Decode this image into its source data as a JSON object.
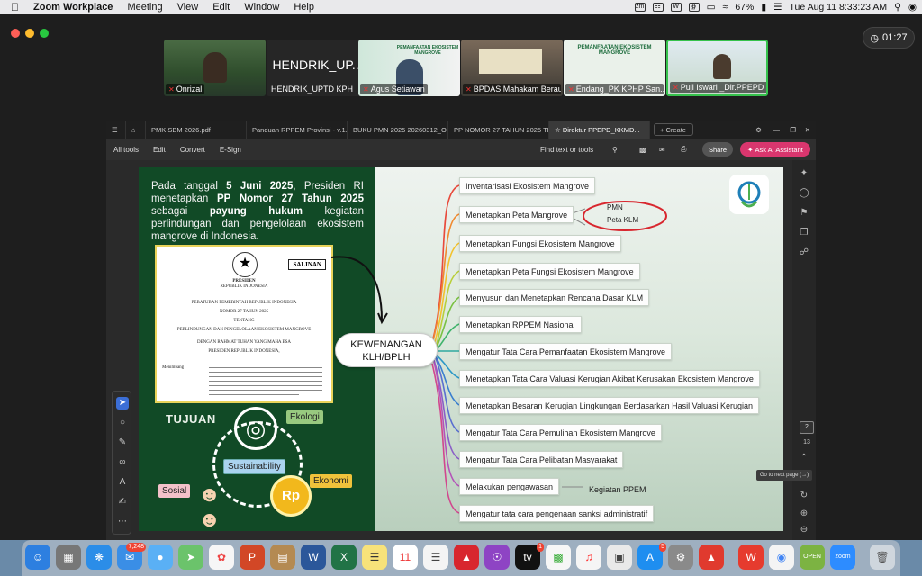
{
  "menubar": {
    "app": "Zoom Workplace",
    "items": [
      "Meeting",
      "View",
      "Edit",
      "Window",
      "Help"
    ],
    "battery": "67%",
    "clock": "Tue Aug 11  8:33:23 AM"
  },
  "zoom": {
    "timer": "01:27",
    "participants": [
      {
        "name": "Onrizal",
        "kind": "video"
      },
      {
        "name": "HENDRIK_UPTD KPH",
        "kind": "name",
        "big": "HENDRIK_UP..."
      },
      {
        "name": "Agus Setiawan",
        "kind": "video"
      },
      {
        "name": "BPDAS Mahakam Berau",
        "kind": "video"
      },
      {
        "name": "Endang_PK KPHP San...",
        "kind": "slide"
      },
      {
        "name": "Puji Iswari _Dir.PPEPD KL...",
        "kind": "video"
      }
    ]
  },
  "acrobat": {
    "tabs": [
      "PMK SBM 2026.pdf",
      "Panduan RPPEM Provinsi - v.1.5 ...",
      "BUKU PMN 2025 20260312_OK...",
      "PP NOMOR 27 TAHUN 2025 TE...",
      "Direktur PPEPD_KKMD..."
    ],
    "create_label": "Create",
    "toolbar": [
      "All tools",
      "Edit",
      "Convert",
      "E-Sign"
    ],
    "find_label": "Find text or tools",
    "share_label": "Share",
    "ai_label": "Ask AI Assistant",
    "page_current": "2",
    "page_total": "13",
    "tooltip": "Go to next page (→)"
  },
  "slide": {
    "intro_parts": [
      "Pada tanggal ",
      "5 Juni 2025",
      ", Presiden RI menetapkan ",
      "PP Nomor 27 Tahun 2025",
      " sebagai ",
      "payung hukum",
      " kegiatan perlindungan dan pengelolaan ekosistem mangrove di Indonesia."
    ],
    "doc": {
      "stamp": "SALINAN",
      "presiden": "PRESIDEN",
      "republik": "REPUBLIK INDONESIA",
      "line1": "PERATURAN PEMERINTAH REPUBLIK INDONESIA",
      "line2": "NOMOR 27 TAHUN 2025",
      "line3": "TENTANG",
      "line4": "PERLINDUNGAN DAN PENGELOLAAN EKOSISTEM MANGROVE",
      "line5": "DENGAN RAHMAT TUHAN YANG MAHA ESA",
      "line6": "PRESIDEN REPUBLIK INDONESIA,",
      "menimbang": "Menimbang"
    },
    "center": "KEWENANGAN KLH/BPLH",
    "tujuan": "TUJUAN",
    "goals": {
      "ekologi": "Ekologi",
      "sustainability": "Sustainability",
      "ekonomi": "Ekonomi",
      "sosial": "Sosial",
      "coin": "Rp"
    },
    "items": [
      "Inventarisasi Ekosistem Mangrove",
      "Menetapkan Peta Mangrove",
      "Menetapkan Fungsi Ekosistem Mangrove",
      "Menetapkan Peta Fungsi Ekosistem Mangrove",
      "Menyusun dan Menetapkan Rencana Dasar KLM",
      "Menetapkan RPPEM Nasional",
      "Mengatur Tata Cara Pemanfaatan Ekosistem Mangrove",
      "Menetapkan Tata Cara Valuasi Kerugian Akibat Kerusakan Ekosistem Mangrove",
      "Menetapkan Besaran Kerugian Lingkungan Berdasarkan Hasil Valuasi Kerugian",
      "Mengatur Tata Cara Pemulihan Ekosistem Mangrove",
      "Mengatur Tata Cara Pelibatan Masyarakat",
      "Melakukan pengawasan",
      "Mengatur tata cara pengenaan sanksi administratif"
    ],
    "peta_notes": [
      "PMN",
      "Peta KLM"
    ],
    "pengawasan_note": "Kegiatan PPEM",
    "highlight_color": "#d8262e"
  },
  "dock": {
    "badge_mail": "7,248",
    "badge_tv": "1",
    "badge_appstore": "5",
    "open_label": "OPEN",
    "zoom_label": "zoom"
  }
}
